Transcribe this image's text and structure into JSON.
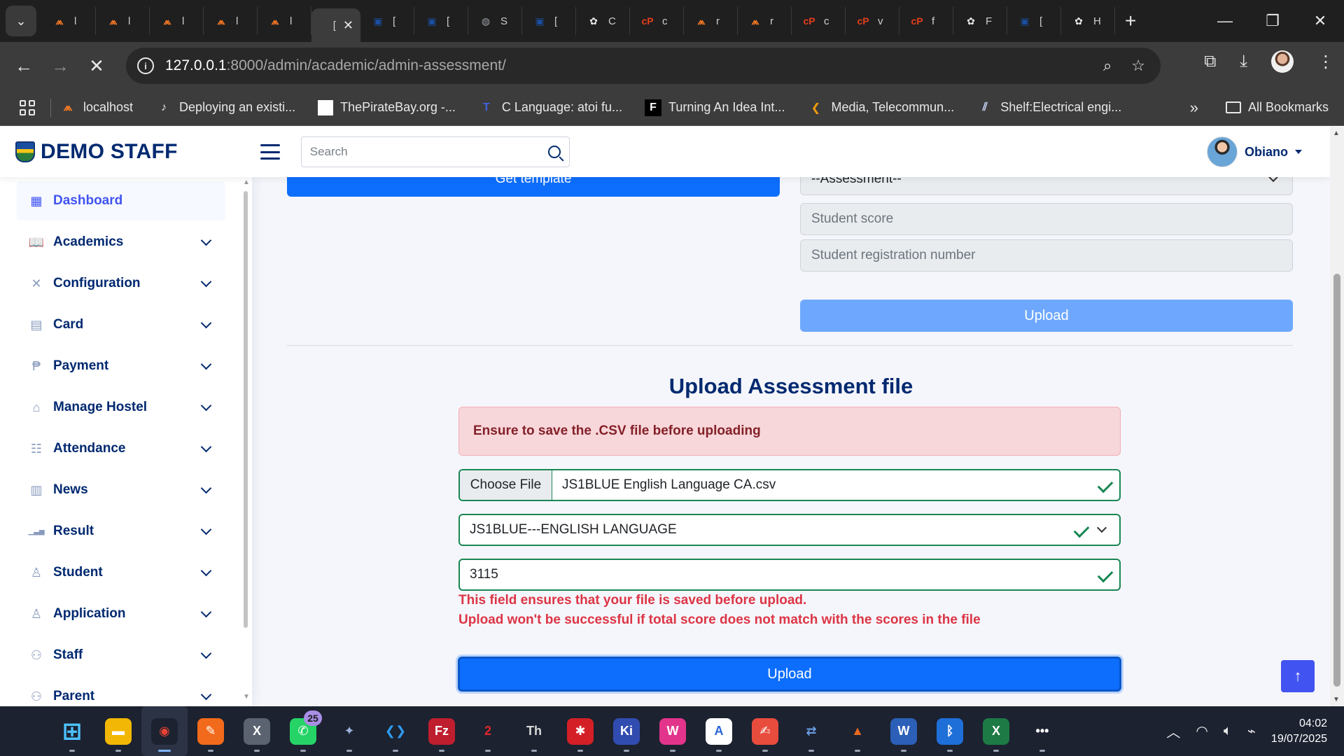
{
  "browser": {
    "tabs": [
      {
        "label": "l",
        "icon": "xampp-icon",
        "color": "#fb7a24"
      },
      {
        "label": "l",
        "icon": "xampp-icon",
        "color": "#fb7a24"
      },
      {
        "label": "l",
        "icon": "xampp-icon",
        "color": "#fb7a24"
      },
      {
        "label": "l",
        "icon": "xampp-icon",
        "color": "#fb7a24"
      },
      {
        "label": "l",
        "icon": "xampp-icon",
        "color": "#fb7a24"
      },
      {
        "label": "[",
        "icon": "page-icon",
        "color": "#9aa0a6",
        "active": true
      },
      {
        "label": "[",
        "icon": "school-crest-icon",
        "color": "#1a4fa0"
      },
      {
        "label": "[",
        "icon": "school-crest-icon",
        "color": "#1a4fa0"
      },
      {
        "label": "S",
        "icon": "globe-icon",
        "color": "#9aa0a6"
      },
      {
        "label": "[",
        "icon": "school-crest-icon",
        "color": "#1a4fa0"
      },
      {
        "label": "C",
        "icon": "chatgpt-icon",
        "color": "#e8e8e8"
      },
      {
        "label": "c",
        "icon": "cp-icon",
        "color": "#e53e1a"
      },
      {
        "label": "r",
        "icon": "xampp-icon",
        "color": "#fb7a24"
      },
      {
        "label": "r",
        "icon": "xampp-icon",
        "color": "#fb7a24"
      },
      {
        "label": "c",
        "icon": "cp-icon",
        "color": "#e53e1a"
      },
      {
        "label": "v",
        "icon": "cp-icon",
        "color": "#e53e1a"
      },
      {
        "label": "f",
        "icon": "cp-icon",
        "color": "#e53e1a"
      },
      {
        "label": "F",
        "icon": "chatgpt-icon",
        "color": "#e8e8e8"
      },
      {
        "label": "[",
        "icon": "school-crest-icon",
        "color": "#1a4fa0"
      },
      {
        "label": "H",
        "icon": "chatgpt-icon",
        "color": "#e8e8e8"
      }
    ],
    "url_host": "127.0.0.1",
    "url_path": ":8000/admin/academic/admin-assessment/",
    "bookmarks": [
      {
        "label": "localhost",
        "icon": "xampp-icon"
      },
      {
        "label": "Deploying an existi...",
        "icon": "guitar-icon"
      },
      {
        "label": "ThePirateBay.org -...",
        "icon": "blank-page-icon"
      },
      {
        "label": "C Language: atoi fu...",
        "icon": "tutorial-icon"
      },
      {
        "label": "Turning An Idea Int...",
        "icon": "f-icon"
      },
      {
        "label": "Media, Telecommun...",
        "icon": "chevron-left-icon"
      },
      {
        "label": "Shelf:Electrical engi...",
        "icon": "shelf-icon"
      }
    ],
    "all_bookmarks": "All Bookmarks"
  },
  "header": {
    "brand": "DEMO STAFF",
    "search_placeholder": "Search",
    "user_name": "Obiano"
  },
  "sidebar": {
    "items": [
      {
        "label": "Dashboard",
        "icon": "grid-icon",
        "glyph": "▦",
        "active": true
      },
      {
        "label": "Academics",
        "icon": "book-icon",
        "glyph": "📖"
      },
      {
        "label": "Configuration",
        "icon": "tools-icon",
        "glyph": "✕"
      },
      {
        "label": "Card",
        "icon": "card-icon",
        "glyph": "▤"
      },
      {
        "label": "Payment",
        "icon": "paypal-icon",
        "glyph": "₱"
      },
      {
        "label": "Manage Hostel",
        "icon": "house-icon",
        "glyph": "⌂"
      },
      {
        "label": "Attendance",
        "icon": "attendance-icon",
        "glyph": "☷"
      },
      {
        "label": "News",
        "icon": "newspaper-icon",
        "glyph": "▥"
      },
      {
        "label": "Result",
        "icon": "bar-chart-icon",
        "glyph": "▁▃▅"
      },
      {
        "label": "Student",
        "icon": "person-icon",
        "glyph": "♙"
      },
      {
        "label": "Application",
        "icon": "person-icon",
        "glyph": "♙"
      },
      {
        "label": "Staff",
        "icon": "people-icon",
        "glyph": "⚇"
      },
      {
        "label": "Parent",
        "icon": "people-icon",
        "glyph": "⚇"
      }
    ]
  },
  "main": {
    "get_template_label": "Get template",
    "assessment_select": "--Assessment--",
    "student_score_placeholder": "Student score",
    "student_reg_placeholder": "Student registration number",
    "upload_top_label": "Upload",
    "section_title": "Upload Assessment file",
    "alert_text": "Ensure to save the .CSV file before uploading",
    "choose_file_label": "Choose File",
    "file_name": "JS1BLUE English Language CA.csv",
    "subject_value": "JS1BLUE---ENGLISH LANGUAGE",
    "total_score_value": "3115",
    "error_line1": "This field ensures that your file is saved before upload.",
    "error_line2": "Upload won't be successful if total score does not match with the scores in the file",
    "upload_label": "Upload"
  },
  "taskbar": {
    "apps": [
      {
        "name": "windows-start-icon",
        "glyph": "⊞",
        "bg": "#1c2230",
        "color": "#4cc2ff"
      },
      {
        "name": "file-explorer-icon",
        "glyph": "▬",
        "bg": "#f2b705",
        "color": "#ffffff"
      },
      {
        "name": "chrome-icon",
        "glyph": "◉",
        "bg": "#1c2230",
        "color": "#ea4335",
        "active": true
      },
      {
        "name": "pen-tool-icon",
        "glyph": "✎",
        "bg": "#f26a1b",
        "color": "#ffffff"
      },
      {
        "name": "mplab-ide-icon",
        "glyph": "X",
        "bg": "#5b6270",
        "color": "#ffffff"
      },
      {
        "name": "whatsapp-icon",
        "glyph": "✆",
        "bg": "#25d366",
        "color": "#ffffff",
        "badge": "25"
      },
      {
        "name": "satellite-app-icon",
        "glyph": "✦",
        "bg": "#1c2230",
        "color": "#9ab0d8"
      },
      {
        "name": "vscode-icon",
        "glyph": "❮❯",
        "bg": "#1c2230",
        "color": "#2f9cf0"
      },
      {
        "name": "filezilla-icon",
        "glyph": "Fz",
        "bg": "#bf1e2e",
        "color": "#ffffff"
      },
      {
        "name": "pickit-icon",
        "glyph": "2",
        "bg": "#1c2230",
        "color": "#e0262d"
      },
      {
        "name": "th-app-icon",
        "glyph": "Th",
        "bg": "#1c2230",
        "color": "#d8d8d8"
      },
      {
        "name": "bug-app-icon",
        "glyph": "✱",
        "bg": "#d41f26",
        "color": "#ffffff"
      },
      {
        "name": "kicad-icon",
        "glyph": "Ki",
        "bg": "#314cb0",
        "color": "#ffffff"
      },
      {
        "name": "wamp-icon",
        "glyph": "W",
        "bg": "#e3348c",
        "color": "#ffffff"
      },
      {
        "name": "app-store-icon",
        "glyph": "A",
        "bg": "#ffffff",
        "color": "#2a65d8"
      },
      {
        "name": "pdf-reader-icon",
        "glyph": "✍",
        "bg": "#e84c3d",
        "color": "#ffffff"
      },
      {
        "name": "network-app-icon",
        "glyph": "⇄",
        "bg": "#1c2230",
        "color": "#6aa0e8"
      },
      {
        "name": "matlab-icon",
        "glyph": "▲",
        "bg": "#1c2230",
        "color": "#e86a1f"
      },
      {
        "name": "word-icon",
        "glyph": "W",
        "bg": "#2b5fb8",
        "color": "#ffffff"
      },
      {
        "name": "bluetooth-icon",
        "glyph": "ᛒ",
        "bg": "#1f6fd8",
        "color": "#ffffff"
      },
      {
        "name": "excel-icon",
        "glyph": "X",
        "bg": "#1d7a45",
        "color": "#ffffff"
      },
      {
        "name": "more-icon",
        "glyph": "•••",
        "bg": "#1c2230",
        "color": "#ffffff"
      }
    ],
    "time": "04:02",
    "date": "19/07/2025"
  }
}
